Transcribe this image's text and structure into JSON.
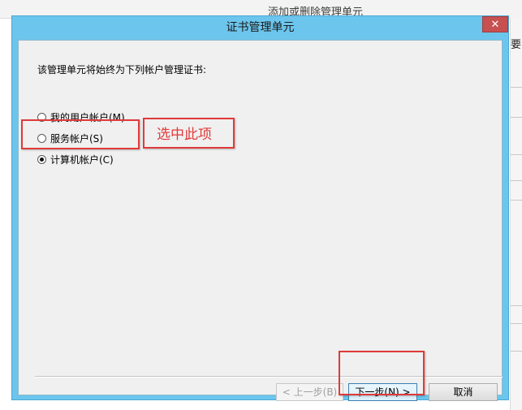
{
  "background_window": {
    "title": "添加或删除管理单元",
    "right_text": "要"
  },
  "dialog": {
    "title": "证书管理单元",
    "close_label": "✕",
    "intro": "该管理单元将始终为下列帐户管理证书:",
    "options": [
      {
        "label": "我的用户帐户(M)",
        "checked": false
      },
      {
        "label": "服务帐户(S)",
        "checked": false
      },
      {
        "label": "计算机帐户(C)",
        "checked": true
      }
    ],
    "annotation": "选中此项",
    "buttons": {
      "back": "< 上一步(B)",
      "next": "下一步(N) >",
      "cancel": "取消"
    }
  },
  "colors": {
    "title_bar": "#6cc5ec",
    "close": "#c75050",
    "highlight": "#e03a3a"
  }
}
